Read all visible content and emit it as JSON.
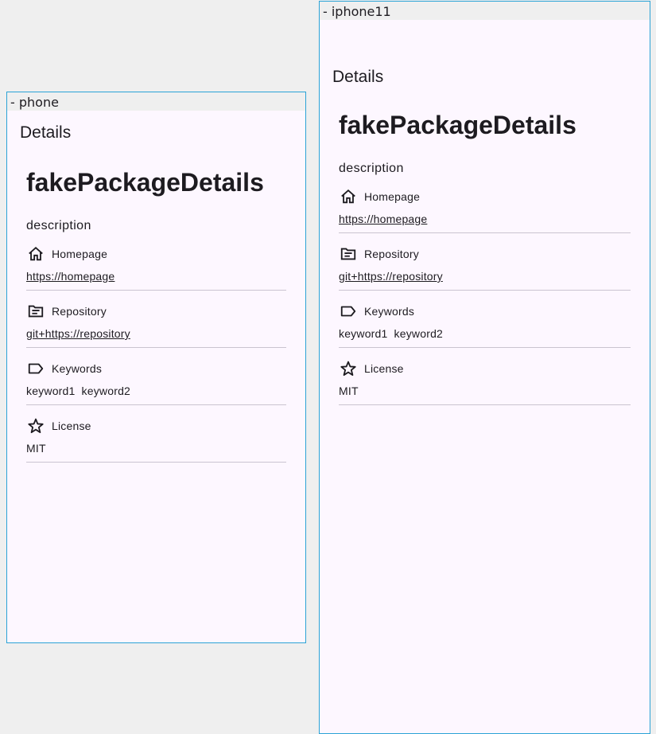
{
  "frames": {
    "phone": {
      "label": "- phone"
    },
    "iphone11": {
      "label": "- iphone11"
    }
  },
  "appbar": {
    "title": "Details"
  },
  "package": {
    "name": "fakePackageDetails",
    "description": "description"
  },
  "sections": {
    "homepage": {
      "label": "Homepage",
      "value": "https://homepage",
      "icon": "home-icon"
    },
    "repository": {
      "label": "Repository",
      "value": "git+https://repository",
      "icon": "folder-icon"
    },
    "keywords": {
      "label": "Keywords",
      "values": [
        "keyword1",
        "keyword2"
      ],
      "icon": "label-tag-icon"
    },
    "license": {
      "label": "License",
      "value": "MIT",
      "icon": "star-icon"
    }
  },
  "colors": {
    "frame_border": "#2ba3d6",
    "surface": "#fdf7ff",
    "divider": "#cac4d0",
    "text": "#1d1b20"
  }
}
